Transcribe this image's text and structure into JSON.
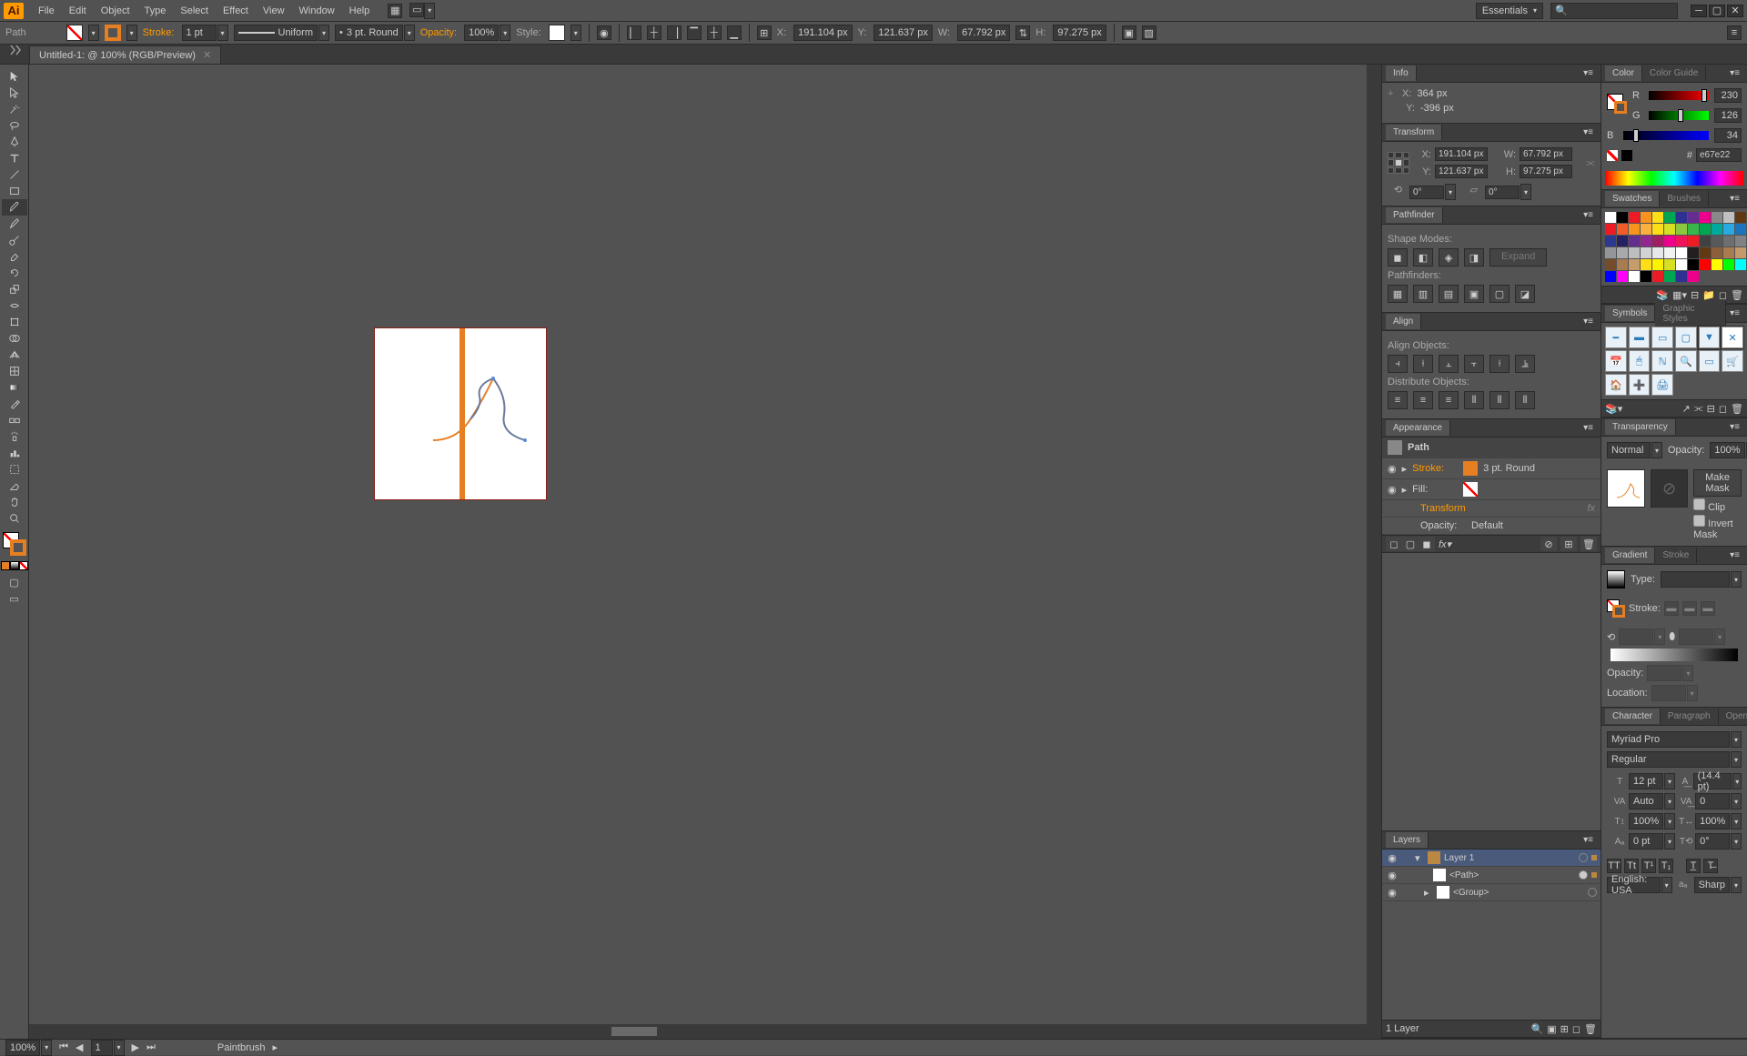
{
  "menubar": {
    "items": [
      "File",
      "Edit",
      "Object",
      "Type",
      "Select",
      "Effect",
      "View",
      "Window",
      "Help"
    ],
    "workspace": "Essentials"
  },
  "controlbar": {
    "selection": "Path",
    "stroke_label": "Stroke:",
    "stroke_weight": "1 pt",
    "profile": "Uniform",
    "brush": "3 pt. Round",
    "opacity_label": "Opacity:",
    "opacity": "100%",
    "style_label": "Style:",
    "x_label": "X:",
    "x": "191.104 px",
    "y_label": "Y:",
    "y": "121.637 px",
    "w_label": "W:",
    "w": "67.792 px",
    "h_label": "H:",
    "h": "97.275 px"
  },
  "doctab": {
    "title": "Untitled-1: @ 100% (RGB/Preview)"
  },
  "info": {
    "title": "Info",
    "x_label": "X:",
    "x": "364 px",
    "y_label": "Y:",
    "y": "-396 px"
  },
  "transform": {
    "title": "Transform",
    "x_label": "X:",
    "x": "191.104 px",
    "y_label": "Y:",
    "y": "121.637 px",
    "w_label": "W:",
    "w": "67.792 px",
    "h_label": "H:",
    "h": "97.275 px",
    "angle": "0°",
    "shear": "0°"
  },
  "pathfinder": {
    "title": "Pathfinder",
    "shape_modes": "Shape Modes:",
    "pathfinders": "Pathfinders:",
    "expand": "Expand"
  },
  "align": {
    "title": "Align",
    "align_obj": "Align Objects:",
    "dist_obj": "Distribute Objects:"
  },
  "appearance": {
    "title": "Appearance",
    "obj": "Path",
    "stroke": "Stroke:",
    "stroke_val": "3 pt. Round",
    "fill": "Fill:",
    "transform": "Transform",
    "opacity": "Opacity:",
    "opacity_val": "Default"
  },
  "layers": {
    "title": "Layers",
    "layer1": "Layer 1",
    "path": "<Path>",
    "group": "<Group>",
    "count": "1 Layer"
  },
  "color": {
    "title": "Color",
    "guide": "Color Guide",
    "r": "230",
    "g": "126",
    "b": "34",
    "hex": "e67e22"
  },
  "swatches": {
    "title": "Swatches",
    "brushes": "Brushes"
  },
  "symbols": {
    "title": "Symbols",
    "styles": "Graphic Styles"
  },
  "transparency": {
    "title": "Transparency",
    "mode": "Normal",
    "opacity_label": "Opacity:",
    "opacity": "100%",
    "make": "Make Mask",
    "clip": "Clip",
    "invert": "Invert Mask"
  },
  "gradient": {
    "title": "Gradient",
    "stroke_tab": "Stroke",
    "type": "Type:",
    "stroke_lbl": "Stroke:",
    "opacity": "Opacity:",
    "location": "Location:"
  },
  "character": {
    "title": "Character",
    "para": "Paragraph",
    "ot": "OpenType",
    "font": "Myriad Pro",
    "style": "Regular",
    "size": "12 pt",
    "leading": "(14.4 pt)",
    "kerning": "Auto",
    "tracking": "0",
    "vscale": "100%",
    "hscale": "100%",
    "baseline": "0 pt",
    "rotation": "0°",
    "lang": "English: USA",
    "aa": "Sharp"
  },
  "statusbar": {
    "zoom": "100%",
    "page": "1",
    "tool": "Paintbrush"
  },
  "swatch_colors": [
    "#fff",
    "#000",
    "#ed1c24",
    "#f7931e",
    "#ffde17",
    "#00a651",
    "#2e3192",
    "#662d91",
    "#ec008c",
    "#898989",
    "#c0c0c0",
    "#603913",
    "#ed1c24",
    "#f15a29",
    "#f7941e",
    "#fbb040",
    "#ffde17",
    "#d7df23",
    "#8dc63f",
    "#39b54a",
    "#00a651",
    "#00a99d",
    "#27aae1",
    "#1c75bc",
    "#2b3990",
    "#262262",
    "#662d91",
    "#92278f",
    "#9e1f63",
    "#ec008c",
    "#ed145b",
    "#ed1c24",
    "#414042",
    "#58595b",
    "#6d6e71",
    "#808285",
    "#939598",
    "#a7a9ac",
    "#bcbec0",
    "#d1d3d4",
    "#e6e7e8",
    "#f1f2f2",
    "#ffffff",
    "#231f20",
    "#603913",
    "#8b5e3c",
    "#a97c50",
    "#c49a6c",
    "#754c29",
    "#a87c4f",
    "#c69c6d",
    "#ffde17",
    "#fff200",
    "#d7df23",
    "#ffffff",
    "#000000",
    "#ff0000",
    "#ffff00",
    "#00ff00",
    "#00ffff",
    "#0000ff",
    "#ff00ff",
    "#ffffff",
    "#000000",
    "#ed1c24",
    "#00a651",
    "#2e3192",
    "#ec008c"
  ]
}
